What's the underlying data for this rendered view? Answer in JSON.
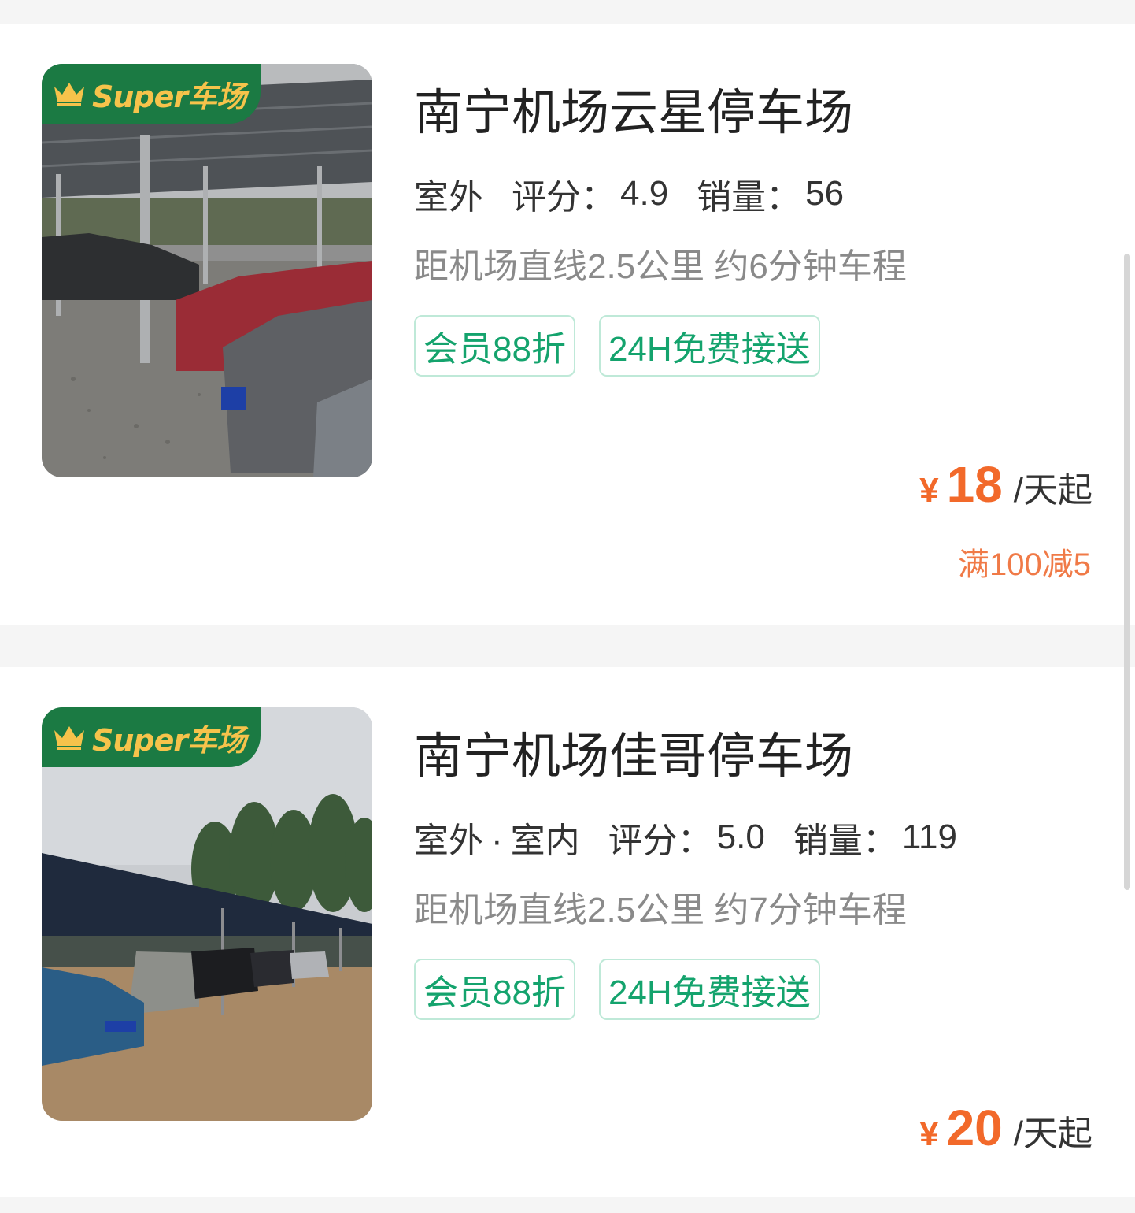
{
  "listings": [
    {
      "badge": "Super车场",
      "name": "南宁机场云星停车场",
      "environment": [
        "室外"
      ],
      "rating_label": "评分：",
      "rating": "4.9",
      "sales_label": "销量：",
      "sales": "56",
      "distance": "距机场直线2.5公里 约6分钟车程",
      "tags": [
        "会员88折",
        "24H免费接送"
      ],
      "currency": "¥",
      "price": "18",
      "price_unit": "/天起",
      "promo": "满100减5"
    },
    {
      "badge": "Super车场",
      "name": "南宁机场佳哥停车场",
      "environment": [
        "室外",
        "室内"
      ],
      "rating_label": "评分：",
      "rating": "5.0",
      "sales_label": "销量：",
      "sales": "119",
      "distance": "距机场直线2.5公里 约7分钟车程",
      "tags": [
        "会员88折",
        "24H免费接送"
      ],
      "currency": "¥",
      "price": "20",
      "price_unit": "/天起"
    }
  ],
  "env_separator": "·",
  "colors": {
    "badge_bg": "#1b7a43",
    "badge_text": "#f6c34b",
    "tag_text": "#14a36d",
    "tag_border": "#bfe9d8",
    "price": "#f2692a",
    "env_underline": "#27c38f"
  }
}
